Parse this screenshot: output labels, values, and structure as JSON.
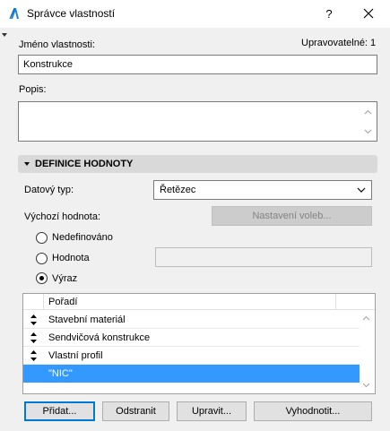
{
  "window": {
    "title": "Správce vlastností",
    "help_glyph": "?",
    "close_glyph": "✕"
  },
  "form": {
    "name_label": "Jméno vlastnosti:",
    "editable_label": "Upravovatelné: 1",
    "name_value": "Konstrukce",
    "description_label": "Popis:",
    "description_value": ""
  },
  "section": {
    "title": "DEFINICE HODNOTY",
    "data_type_label": "Datový typ:",
    "data_type_value": "Řetězec",
    "default_value_label": "Výchozí hodnota:",
    "options_button": "Nastavení voleb...",
    "radios": [
      {
        "label": "Nedefinováno",
        "checked": false
      },
      {
        "label": "Hodnota",
        "checked": false
      },
      {
        "label": "Výraz",
        "checked": true
      }
    ],
    "value_field": ""
  },
  "list": {
    "header": "Pořadí",
    "rows": [
      {
        "label": "Stavební materiál",
        "selected": false
      },
      {
        "label": "Sendvičová konstrukce",
        "selected": false
      },
      {
        "label": "Vlastní profil",
        "selected": false
      },
      {
        "label": "\"NIC\"",
        "selected": true
      }
    ]
  },
  "buttons": {
    "add": "Přidat...",
    "remove": "Odstranit",
    "edit": "Upravit...",
    "evaluate": "Vyhodnotit..."
  },
  "colors": {
    "selection": "#3399ff",
    "accent": "#0078d7"
  }
}
